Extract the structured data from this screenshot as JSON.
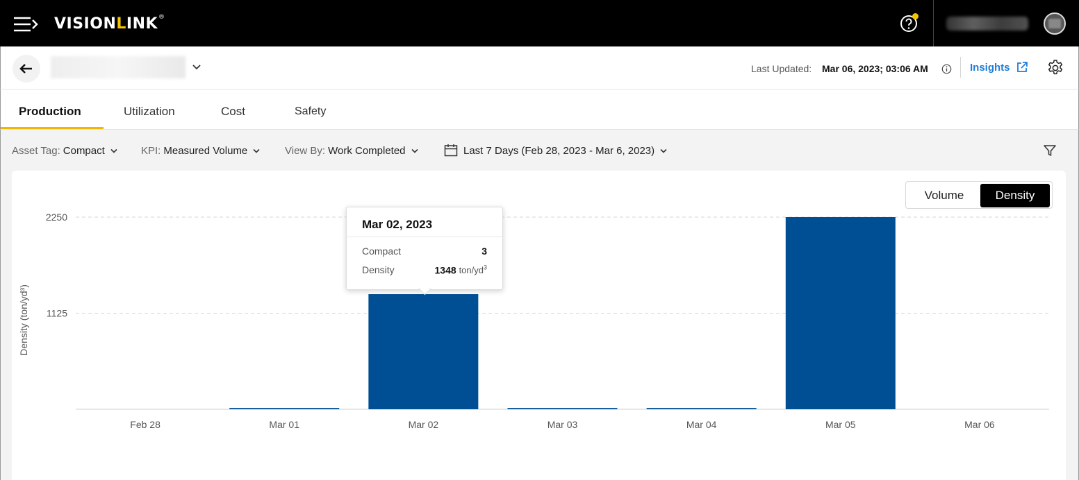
{
  "app": {
    "brand_prefix": "VISION",
    "brand_l": "L",
    "brand_suffix": "INK",
    "brand_mark": "®"
  },
  "header": {
    "last_updated_label": "Last Updated:",
    "last_updated_value": "Mar 06, 2023; 03:06 AM",
    "insights_label": "Insights"
  },
  "tabs": [
    {
      "label": "Production",
      "active": true
    },
    {
      "label": "Utilization",
      "active": false
    },
    {
      "label": "Cost",
      "active": false
    },
    {
      "label": "Safety",
      "active": false
    }
  ],
  "filters": {
    "asset_tag_label": "Asset Tag:",
    "asset_tag_value": "Compact",
    "kpi_label": "KPI:",
    "kpi_value": "Measured Volume",
    "view_by_label": "View By:",
    "view_by_value": "Work Completed",
    "date_range": "Last 7 Days (Feb 28, 2023 - Mar 6, 2023)"
  },
  "toggle": {
    "volume_label": "Volume",
    "density_label": "Density",
    "selected": "Density"
  },
  "tooltip": {
    "title": "Mar 02, 2023",
    "row1_label": "Compact",
    "row1_value": "3",
    "row2_label": "Density",
    "row2_value": "1348",
    "row2_unit": "ton/yd",
    "row2_unit_sup": "3"
  },
  "colors": {
    "bar": "#004f94",
    "accent": "#f2b600",
    "link": "#1f7ed8"
  },
  "chart_data": {
    "type": "bar",
    "ylabel": "Density (ton/yd³)",
    "categories": [
      "Feb 28",
      "Mar 01",
      "Mar 02",
      "Mar 03",
      "Mar 04",
      "Mar 05",
      "Mar 06"
    ],
    "values": [
      0,
      15,
      1348,
      15,
      15,
      2250,
      0
    ],
    "yticks": [
      1125,
      2250
    ],
    "ylim": [
      0,
      2250
    ],
    "grid": true
  }
}
